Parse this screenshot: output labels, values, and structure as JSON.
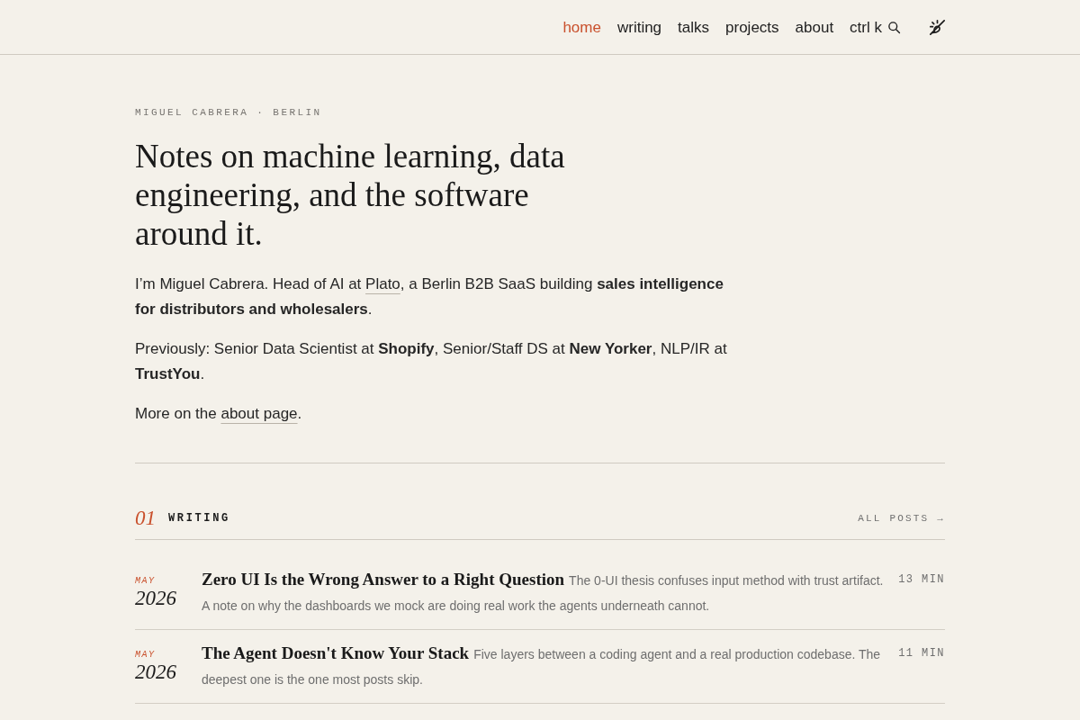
{
  "header": {
    "nav": [
      {
        "label": "home",
        "selected": true
      },
      {
        "label": "writing",
        "selected": false
      },
      {
        "label": "talks",
        "selected": false
      },
      {
        "label": "projects",
        "selected": false
      },
      {
        "label": "about",
        "selected": false
      }
    ],
    "search": {
      "label": "ctrl k"
    }
  },
  "intro": {
    "kicker": "MIGUEL CABRERA · BERLIN",
    "heading": "Notes on machine learning, data engineering, and the software around it.",
    "paragraphs": [
      [
        {
          "kind": "text",
          "text": "I’m Miguel Cabrera. Head of AI at "
        },
        {
          "kind": "link",
          "text": "Plato"
        },
        {
          "kind": "text",
          "text": ", a Berlin B2B SaaS building **sales intelligence for distributors and wholesalers**."
        }
      ],
      [
        {
          "kind": "text",
          "text": "Previously: Senior Data Scientist at **Shopify**, Senior/Staff DS at **New Yorker**, NLP/IR at **TrustYou**."
        }
      ],
      [
        {
          "kind": "text",
          "text": "More on the "
        },
        {
          "kind": "link",
          "text": "about page"
        },
        {
          "kind": "text",
          "text": "."
        }
      ]
    ]
  },
  "writing_section": {
    "number": "01",
    "title": "WRITING",
    "all_posts": "ALL POSTS →",
    "posts": [
      {
        "month": "MAY",
        "year": "2026",
        "title": "Zero UI Is the Wrong Answer to a Right Question",
        "summary": "The 0-UI thesis confuses input method with trust artifact. A note on why the dashboards we mock are doing real work the agents underneath cannot.",
        "read_time": "13 MIN"
      },
      {
        "month": "MAY",
        "year": "2026",
        "title": "The Agent Doesn't Know Your Stack",
        "summary": "Five layers between a coding agent and a real production codebase. The deepest one is the one most posts skip.",
        "read_time": "11 MIN"
      }
    ]
  }
}
